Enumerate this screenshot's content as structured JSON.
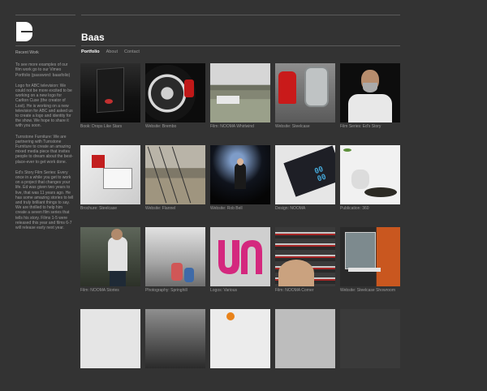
{
  "brand": {
    "logo_letter": "B"
  },
  "site": {
    "title": "Baas"
  },
  "nav": [
    {
      "label": "Portfolio",
      "active": true
    },
    {
      "label": "About",
      "active": false
    },
    {
      "label": "Contact",
      "active": false
    }
  ],
  "sidebar": {
    "recent_label": "Recent Work",
    "paragraphs": [
      "To see more examples of our film work go to our Vimeo Portfolio (password: baasfolio)",
      "Logo for ABC television: We could not be more excited to be working on a new logo for Carlton Cuse (the creator of Lost). He is working on a new television for ABC and asked us to create a logo and identity for the show. We hope to share it with you soon.",
      "Turnstone Furniture: We are partnering with Turnstone Furniture to create an amazing mixed media piece that invites people to dream about the best-place-ever to get work done.",
      "Ed's Story Film Series: Every once in a while you get to work on a project that changes your life. Ed was given two years to live, that was 11 years ago. He has some amazing stories to tell and truly brilliant things to say. We are thrilled to help him create a seven film series that tells his story. Films 1-5 were released this year and films 6-7 will release early next year."
    ]
  },
  "portfolio": {
    "items": [
      {
        "caption": "Book: Drops Like Stars"
      },
      {
        "caption": "Website: Brembo"
      },
      {
        "caption": "Film: NOOMA Whirlwind"
      },
      {
        "caption": "Website: Steelcase"
      },
      {
        "caption": "Film Series: Ed's Story"
      },
      {
        "caption": "Brochure: Steelcase"
      },
      {
        "caption": "Website: Flannel"
      },
      {
        "caption": "Website: Rob Bell"
      },
      {
        "caption": "Design: NOOMA"
      },
      {
        "caption": "Publication: 360"
      },
      {
        "caption": "Film: NOOMA Stories"
      },
      {
        "caption": "Photography: Springhill"
      },
      {
        "caption": "Logos: Various"
      },
      {
        "caption": "Film: NOOMA Corner"
      },
      {
        "caption": "Website: Steelcase Showroom"
      },
      {
        "caption": ""
      },
      {
        "caption": ""
      },
      {
        "caption": ""
      },
      {
        "caption": ""
      },
      {
        "caption": ""
      }
    ]
  },
  "thumb_text": {
    "design_digits": "00 00"
  },
  "colors": {
    "background": "#333333",
    "logo_magenta": "#d4287e",
    "text_primary": "#ffffff",
    "text_muted": "#9a9a9a"
  }
}
